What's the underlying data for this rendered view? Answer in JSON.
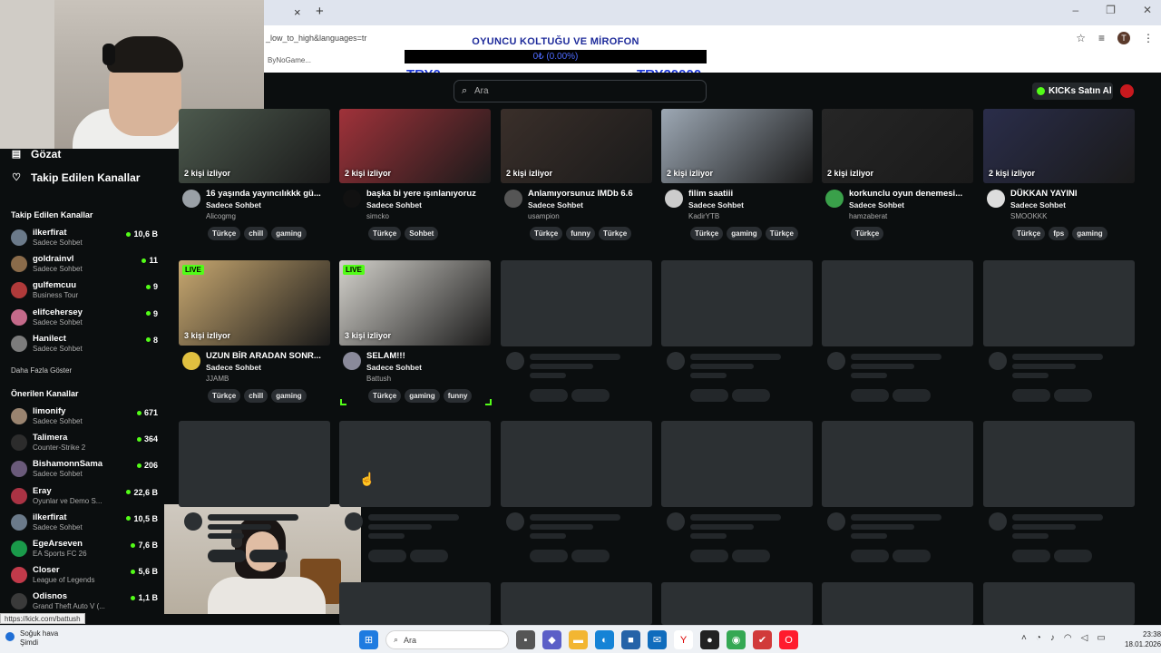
{
  "browser": {
    "tab_close": "×",
    "new_tab": "+",
    "window_controls": [
      "–",
      "❐",
      "✕"
    ],
    "url": "_low_to_high&languages=tr",
    "bookmark": "ByNoGame...",
    "profile_initial": "T"
  },
  "donation": {
    "title": "OYUNCU KOLTUĞU VE MİROFON",
    "progress_text": "0₺ (0.00%)",
    "progress_fraction": 0,
    "min_label": "TRY0",
    "max_label": "TRY20000"
  },
  "header": {
    "search_placeholder": "Ara",
    "kicks_button": "KICKs Satın Al",
    "kicks_color": "#53fc18"
  },
  "sidebar": {
    "nav": [
      {
        "label": "Gözat",
        "icon": "browse-icon"
      },
      {
        "label": "Takip Edilen Kanallar",
        "icon": "heart-icon"
      }
    ],
    "followed_title": "Takip Edilen Kanallar",
    "followed": [
      {
        "name": "ilkerfirat",
        "category": "Sadece Sohbet",
        "viewers": "10,6 B",
        "color": "#6b7a8a"
      },
      {
        "name": "goldrainvl",
        "category": "Sadece Sohbet",
        "viewers": "11",
        "color": "#8a6b4a"
      },
      {
        "name": "gulfemcuu",
        "category": "Business Tour",
        "viewers": "9",
        "color": "#b03a3a"
      },
      {
        "name": "elifcehersey",
        "category": "Sadece Sohbet",
        "viewers": "9",
        "color": "#c46a8a"
      },
      {
        "name": "Hanilect",
        "category": "Sadece Sohbet",
        "viewers": "8",
        "color": "#7c7c7c"
      }
    ],
    "more_label": "Daha Fazla Göster",
    "recommended_title": "Önerilen Kanallar",
    "recommended": [
      {
        "name": "limonify",
        "category": "Sadece Sohbet",
        "viewers": "671",
        "color": "#9a8470"
      },
      {
        "name": "Talimera",
        "category": "Counter-Strike 2",
        "viewers": "364",
        "color": "#2c2c2c"
      },
      {
        "name": "BishamonnSama",
        "category": "Sadece Sohbet",
        "viewers": "206",
        "color": "#6a5a7a"
      },
      {
        "name": "Eray",
        "category": "Oyunlar ve Demo S...",
        "viewers": "22,6 B",
        "color": "#aa3344"
      },
      {
        "name": "ilkerfirat",
        "category": "Sadece Sohbet",
        "viewers": "10,5 B",
        "color": "#6b7a8a"
      },
      {
        "name": "EgeArseven",
        "category": "EA Sports FC 26",
        "viewers": "7,6 B",
        "color": "#1a9a4a"
      },
      {
        "name": "Closer",
        "category": "League of Legends",
        "viewers": "5,6 B",
        "color": "#c23a4a"
      },
      {
        "name": "Odisnos",
        "category": "Grand Theft Auto V (...",
        "viewers": "1,1 B",
        "color": "#3a3a3a"
      }
    ]
  },
  "streams_row1": [
    {
      "title": "16 yaşında yayıncılıkkk gü...",
      "category": "Sadece Sohbet",
      "user": "Alicogmg",
      "viewers": "2 kişi izliyor",
      "tags": [
        "Türkçe",
        "chill",
        "gaming"
      ],
      "thumb_color": "#4d5a4e",
      "avatar_color": "#9aa0a6"
    },
    {
      "title": "başka bi yere ışınlanıyoruz",
      "category": "Sadece Sohbet",
      "user": "simcko",
      "viewers": "2 kişi izliyor",
      "tags": [
        "Türkçe",
        "Sohbet"
      ],
      "thumb_color": "#a0323a",
      "avatar_color": "#111111"
    },
    {
      "title": "Anlamıyorsunuz IMDb 6.6",
      "category": "Sadece Sohbet",
      "user": "usampion",
      "viewers": "2 kişi izliyor",
      "tags": [
        "Türkçe",
        "funny",
        "Türkçe"
      ],
      "thumb_color": "#3a2f2a",
      "avatar_color": "#555555"
    },
    {
      "title": "filim saatiii",
      "category": "Sadece Sohbet",
      "user": "KadirYTB",
      "viewers": "2 kişi izliyor",
      "tags": [
        "Türkçe",
        "gaming",
        "Türkçe"
      ],
      "thumb_color": "#9da8b4",
      "avatar_color": "#cccccc"
    },
    {
      "title": "korkunclu oyun denemesi...",
      "category": "Sadece Sohbet",
      "user": "hamzaberat",
      "viewers": "2 kişi izliyor",
      "tags": [
        "Türkçe"
      ],
      "thumb_color": "#262626",
      "avatar_color": "#3aa04a"
    },
    {
      "title": "DÜKKAN YAYINI",
      "category": "Sadece Sohbet",
      "user": "SMOOKKK",
      "viewers": "2 kişi izliyor",
      "tags": [
        "Türkçe",
        "fps",
        "gaming"
      ],
      "thumb_color": "#2a2d4a",
      "avatar_color": "#dddddd"
    }
  ],
  "streams_row2": [
    {
      "title": "UZUN BİR ARADAN SONR...",
      "category": "Sadece Sohbet",
      "user": "JJAMB",
      "viewers": "3 kişi izliyor",
      "tags": [
        "Türkçe",
        "chill",
        "gaming"
      ],
      "thumb_color": "#c8a870",
      "avatar_color": "#e0c040",
      "live": "LIVE"
    },
    {
      "title": "SELAM!!!",
      "category": "Sadece Sohbet",
      "user": "Battush",
      "viewers": "3 kişi izliyor",
      "tags": [
        "Türkçe",
        "gaming",
        "funny"
      ],
      "thumb_color": "#d4d2cc",
      "avatar_color": "#8a8a9a",
      "live": "LIVE"
    }
  ],
  "status_url": "https://kick.com/battush",
  "taskbar": {
    "weather_title": "Soğuk hava",
    "weather_sub": "Şimdi",
    "search": "Ara",
    "time": "23:38",
    "date": "18.01.2026",
    "apps": [
      {
        "icon": "files-icon",
        "color": "#555555",
        "glyph": "▪"
      },
      {
        "icon": "teams-icon",
        "color": "#5b5fc7",
        "glyph": "◆"
      },
      {
        "icon": "folder-icon",
        "color": "#f2b632",
        "glyph": "▬"
      },
      {
        "icon": "edge-icon",
        "color": "#1583d6",
        "glyph": "◐"
      },
      {
        "icon": "store-icon",
        "color": "#2563a8",
        "glyph": "■"
      },
      {
        "icon": "outlook-icon",
        "color": "#0f6cbd",
        "glyph": "✉"
      },
      {
        "icon": "yandex-icon",
        "color": "#ffffff",
        "glyph": "Y"
      },
      {
        "icon": "obs-icon",
        "color": "#222222",
        "glyph": "●"
      },
      {
        "icon": "chrome-icon",
        "color": "#34a853",
        "glyph": "◉"
      },
      {
        "icon": "app-red-icon",
        "color": "#d13a3a",
        "glyph": "✔"
      },
      {
        "icon": "opera-icon",
        "color": "#ff1b2d",
        "glyph": "O"
      }
    ]
  }
}
